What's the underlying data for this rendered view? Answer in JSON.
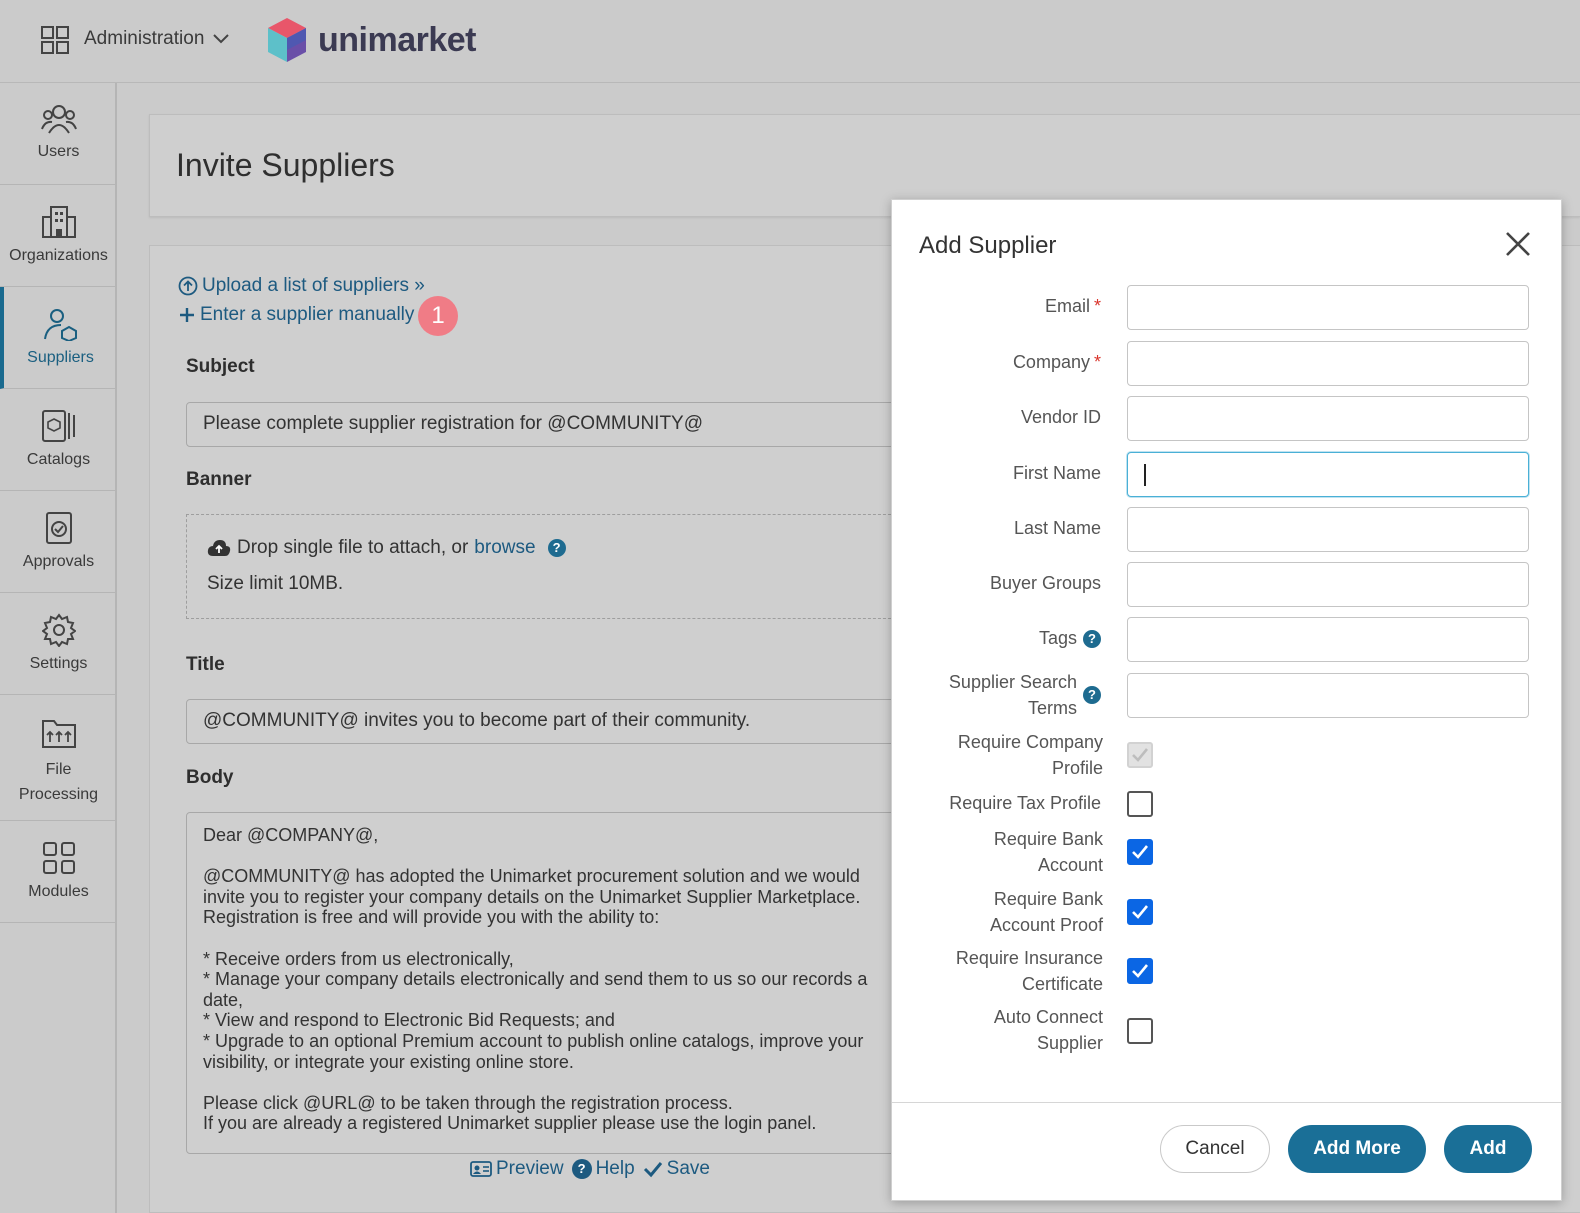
{
  "header": {
    "menu_label": "Administration",
    "brand": "unimarket"
  },
  "sidebar": {
    "items": [
      {
        "label": "Users",
        "icon": "users-icon"
      },
      {
        "label": "Organizations",
        "icon": "building-icon"
      },
      {
        "label": "Suppliers",
        "icon": "supplier-icon",
        "active": true
      },
      {
        "label": "Catalogs",
        "icon": "catalog-icon"
      },
      {
        "label": "Approvals",
        "icon": "approval-icon"
      },
      {
        "label": "Settings",
        "icon": "gear-icon"
      },
      {
        "label": "File Processing",
        "icon": "folder-processing-icon"
      },
      {
        "label": "Modules",
        "icon": "modules-icon"
      }
    ]
  },
  "page": {
    "title": "Invite Suppliers",
    "upload_link": "Upload a list of suppliers »",
    "manual_link": "Enter a supplier manually",
    "step_badge": "1",
    "subject_label": "Subject",
    "subject_value": "Please complete supplier registration for @COMMUNITY@",
    "banner_label": "Banner",
    "drop_text": "Drop single file to attach, or",
    "browse_link": "browse",
    "size_limit": "Size limit 10MB.",
    "title_label": "Title",
    "title_value": "@COMMUNITY@ invites you to become part of their community.",
    "body_label": "Body",
    "body_value": "Dear @COMPANY@,\n\n@COMMUNITY@ has adopted the Unimarket procurement solution and we would\ninvite you to register your company details on the Unimarket Supplier Marketplace.\nRegistration is free and will provide you with the ability to:\n\n* Receive orders from us electronically,\n* Manage your company details electronically and send them to us so our records a\ndate,\n* View and respond to Electronic Bid Requests; and\n* Upgrade to an optional Premium account to publish online catalogs, improve your\nvisibility, or integrate your existing online store.\n\nPlease click @URL@ to be taken through the registration process.\nIf you are already a registered Unimarket supplier please use the login panel.",
    "preview": "Preview",
    "help": "Help",
    "save": "Save"
  },
  "modal": {
    "title": "Add Supplier",
    "fields": {
      "email": "Email",
      "company": "Company",
      "vendor_id": "Vendor ID",
      "first_name": "First Name",
      "last_name": "Last Name",
      "buyer_groups": "Buyer Groups",
      "tags": "Tags",
      "search_terms": "Supplier Search Terms"
    },
    "checkboxes": {
      "company_profile": {
        "label": "Require Company Profile",
        "checked": true,
        "disabled": true
      },
      "tax_profile": {
        "label": "Require Tax Profile",
        "checked": false
      },
      "bank_account": {
        "label": "Require Bank Account",
        "checked": true
      },
      "bank_proof": {
        "label": "Require Bank Account Proof",
        "checked": true
      },
      "insurance": {
        "label": "Require Insurance Certificate",
        "checked": true
      },
      "auto_connect": {
        "label": "Auto Connect Supplier",
        "checked": false
      }
    },
    "buttons": {
      "cancel": "Cancel",
      "add_more": "Add More",
      "add": "Add"
    }
  },
  "colors": {
    "accent": "#1a6f97",
    "checkbox": "#0b66e4",
    "badge": "#f07c86",
    "required": "#d9342b"
  }
}
